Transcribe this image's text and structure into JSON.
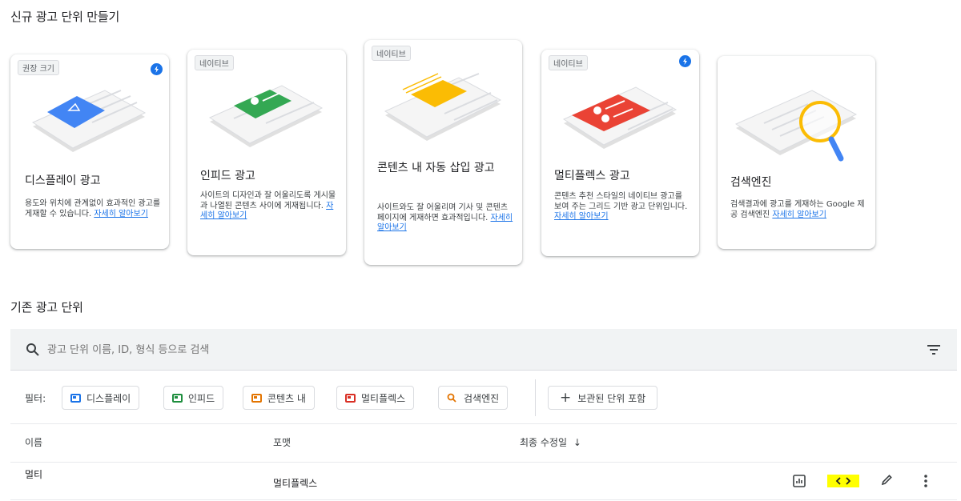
{
  "new_section": {
    "title": "신규 광고 단위 만들기"
  },
  "cards": [
    {
      "tag": "권장 크기",
      "title": "디스플레이 광고",
      "desc": "용도와 위치에 관계없이 효과적인 광고를 게재할 수 있습니다.",
      "link": "자세히 알아보기",
      "badge_icon": "bolt-icon",
      "illustration": "display-ad-illustration"
    },
    {
      "tag": "네이티브",
      "title": "인피드 광고",
      "desc": "사이트의 디자인과 잘 어울리도록 게시물과 나열된 콘텐츠 사이에 게재됩니다.",
      "link": "자세히 알아보기",
      "illustration": "infeed-ad-illustration"
    },
    {
      "tag": "네이티브",
      "title": "콘텐츠 내 자동 삽입 광고",
      "desc": "사이트와도 잘 어울리며 기사 및 콘텐츠 페이지에 게재하면 효과적입니다.",
      "link": "자세히 알아보기",
      "illustration": "in-article-ad-illustration"
    },
    {
      "tag": "네이티브",
      "title": "멀티플렉스 광고",
      "desc": "콘텐츠 추천 스타일의 네이티브 광고를 보여 주는 그리드 기반 광고 단위입니다.",
      "link": "자세히 알아보기",
      "badge_icon": "bolt-icon",
      "illustration": "multiplex-ad-illustration"
    },
    {
      "tag": "",
      "title": "검색엔진",
      "desc": "검색결과에 광고를 게재하는 Google 제공 검색엔진",
      "link": "자세히 알아보기",
      "illustration": "search-engine-illustration"
    }
  ],
  "existing_section": {
    "title": "기존 광고 단위"
  },
  "search": {
    "placeholder": "광고 단위 이름, ID, 형식 등으로 검색"
  },
  "filters": {
    "label": "필터:",
    "chips": [
      {
        "label": "디스플레이",
        "icon": "display-icon",
        "color": "#1a73e8"
      },
      {
        "label": "인피드",
        "icon": "infeed-icon",
        "color": "#1e8e3e"
      },
      {
        "label": "콘텐츠 내",
        "icon": "in-article-icon",
        "color": "#e37400"
      },
      {
        "label": "멀티플렉스",
        "icon": "multiplex-icon",
        "color": "#d93025"
      },
      {
        "label": "검색엔진",
        "icon": "search-engine-icon",
        "color": "#e37400"
      }
    ],
    "archived_label": "보관된 단위 포함"
  },
  "table": {
    "columns": [
      "이름",
      "포맷",
      "최종 수정일"
    ],
    "rows": [
      {
        "name": "멀티",
        "format": "멀티플렉스",
        "modified": ""
      }
    ]
  },
  "colors": {
    "accent": "#1a73e8",
    "highlight": "#ffff00"
  }
}
